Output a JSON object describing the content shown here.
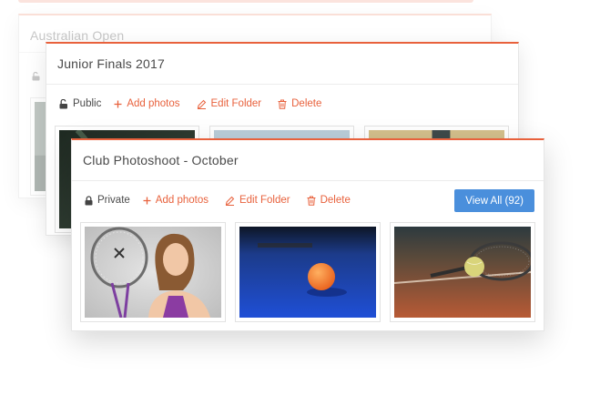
{
  "background_card": {
    "title": "Australian Open"
  },
  "junior_card": {
    "title": "Junior Finals 2017",
    "visibility": "Public",
    "add_photos": "Add photos",
    "edit_folder": "Edit Folder",
    "delete": "Delete"
  },
  "club_card": {
    "title": "Club Photoshoot - October",
    "visibility": "Private",
    "add_photos": "Add photos",
    "edit_folder": "Edit Folder",
    "delete": "Delete",
    "view_all": "View All (92)"
  },
  "colors": {
    "accent": "#e8613c",
    "button_blue": "#4a8fdc"
  },
  "icons": [
    "unlock-icon",
    "lock-icon",
    "plus-icon",
    "pencil-icon",
    "trash-icon"
  ]
}
